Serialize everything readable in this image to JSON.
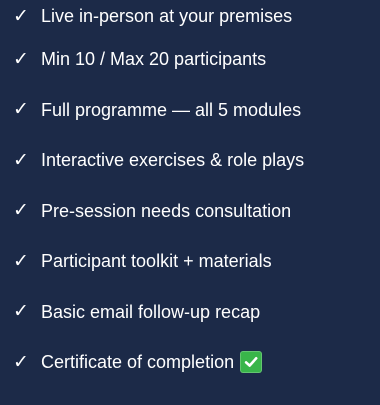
{
  "features": {
    "items": [
      {
        "label": "Live in-person at your premises",
        "icon": "checkmark-icon"
      },
      {
        "label": "Min 10 / Max 20 participants",
        "icon": "checkmark-icon"
      },
      {
        "label": "Full programme — all 5 modules",
        "icon": "checkmark-icon"
      },
      {
        "label": "Interactive exercises & role plays",
        "icon": "checkmark-icon"
      },
      {
        "label": "Pre-session needs consultation",
        "icon": "checkmark-icon"
      },
      {
        "label": "Participant toolkit + materials",
        "icon": "checkmark-icon"
      },
      {
        "label": "Basic email follow-up recap",
        "icon": "checkmark-icon"
      },
      {
        "label": "Certificate of completion",
        "icon": "checkmark-icon",
        "badge": "green-checkbox-icon"
      }
    ],
    "check_glyph": "✓",
    "colors": {
      "background": "#1c2a48",
      "text": "#ffffff",
      "badge": "#39b54a"
    }
  }
}
